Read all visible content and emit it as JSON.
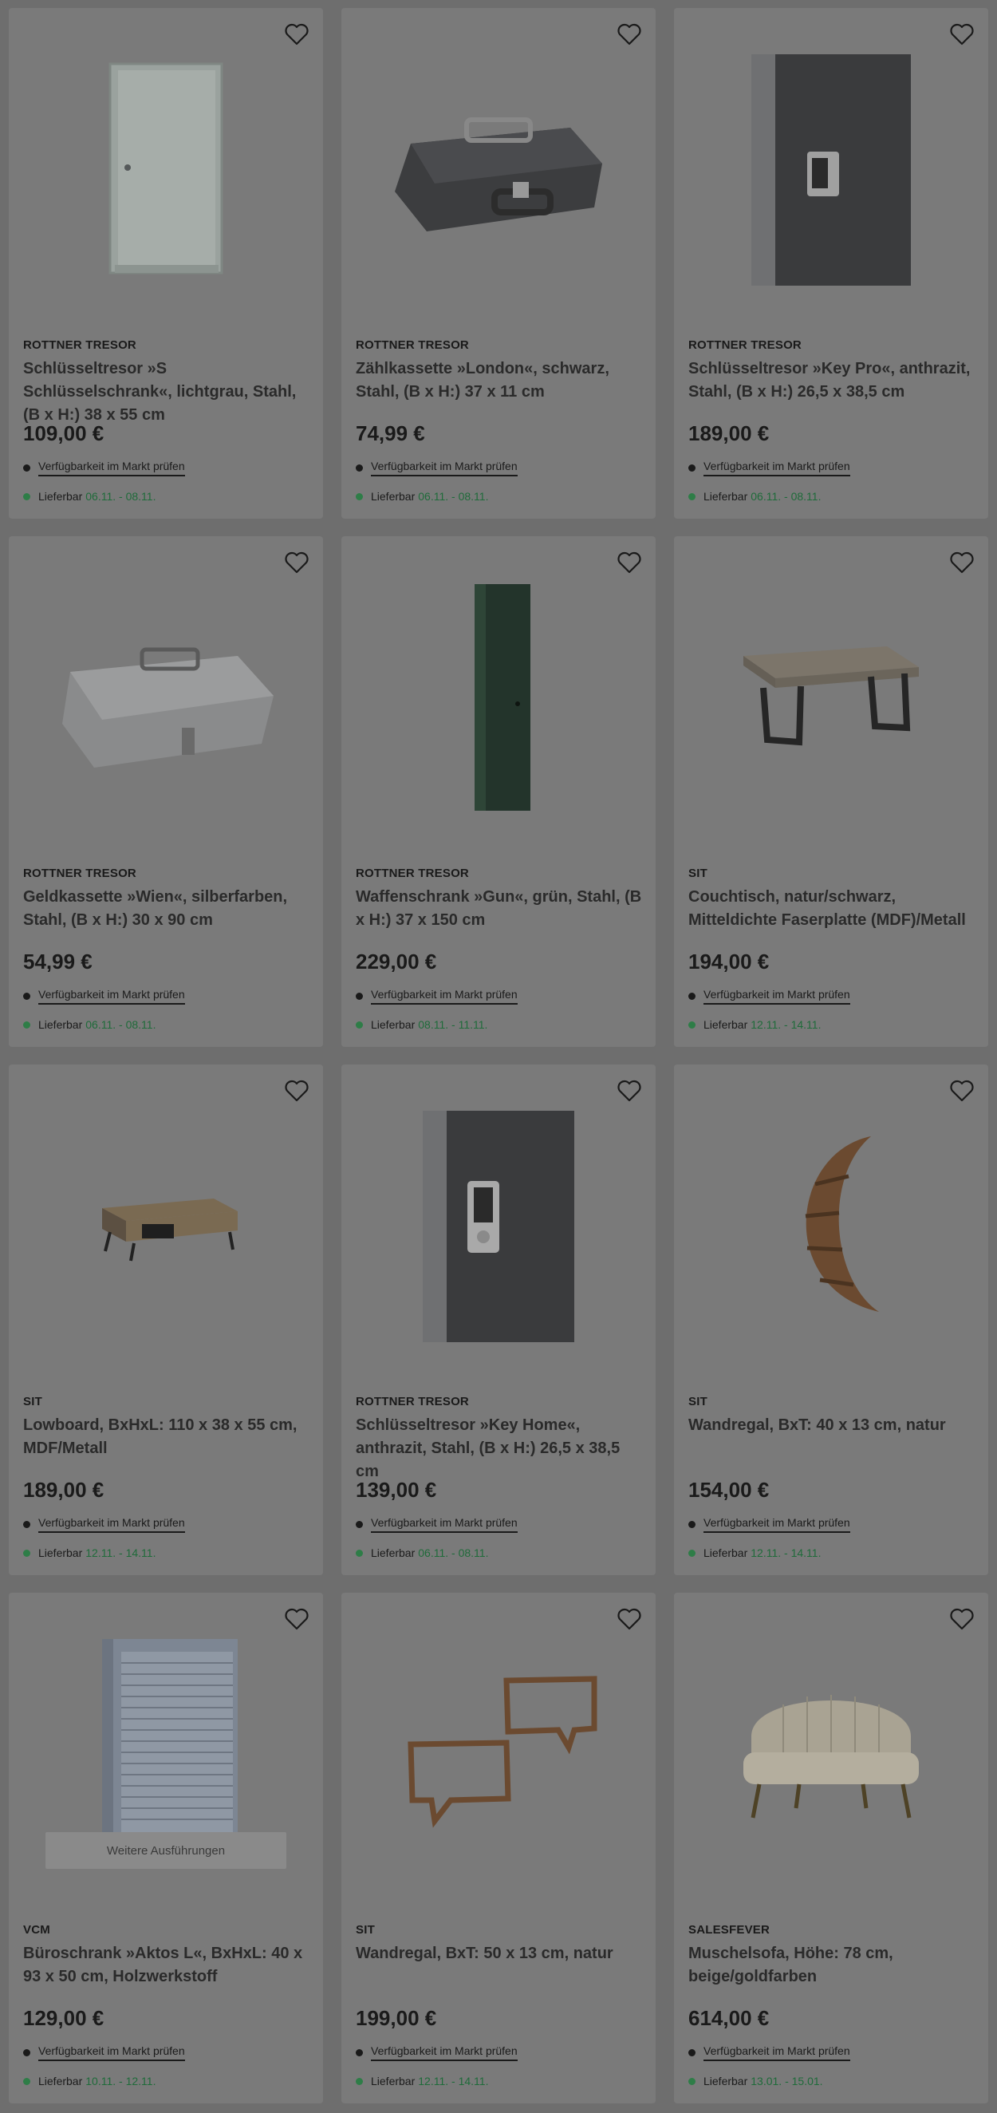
{
  "availability_label": "Verfügbarkeit im Markt prüfen",
  "delivery_label": "Lieferbar",
  "products": [
    {
      "brand": "ROTTNER TRESOR",
      "title": "Schlüsseltresor »S Schlüsselschrank«, lichtgrau, Stahl, (B x H:) 38 x 55 cm",
      "price": "109,00 €",
      "delivery": "06.11. - 08.11.",
      "icon": "key-cabinet-grey"
    },
    {
      "brand": "ROTTNER TRESOR",
      "title": "Zählkassette »London«, schwarz, Stahl, (B x H:) 37 x 11 cm",
      "price": "74,99 €",
      "delivery": "06.11. - 08.11.",
      "icon": "cash-box-black"
    },
    {
      "brand": "ROTTNER TRESOR",
      "title": "Schlüsseltresor »Key Pro«, anthrazit, Stahl, (B x H:) 26,5 x 38,5 cm",
      "price": "189,00 €",
      "delivery": "06.11. - 08.11.",
      "icon": "key-safe-anthracite"
    },
    {
      "brand": "ROTTNER TRESOR",
      "title": "Geldkassette »Wien«, silberfarben, Stahl, (B x H:) 30 x 90 cm",
      "price": "54,99 €",
      "delivery": "06.11. - 08.11.",
      "icon": "cash-box-silver"
    },
    {
      "brand": "ROTTNER TRESOR",
      "title": "Waffenschrank »Gun«, grün, Stahl, (B x H:) 37 x 150 cm",
      "price": "229,00 €",
      "delivery": "08.11. - 11.11.",
      "icon": "gun-cabinet-green"
    },
    {
      "brand": "SIT",
      "title": "Couchtisch, natur/schwarz, Mitteldichte Faserplatte (MDF)/Metall",
      "price": "194,00 €",
      "delivery": "12.11. - 14.11.",
      "icon": "coffee-table"
    },
    {
      "brand": "SIT",
      "title": "Lowboard, BxHxL: 110 x 38 x 55 cm, MDF/Metall",
      "price": "189,00 €",
      "delivery": "12.11. - 14.11.",
      "icon": "lowboard"
    },
    {
      "brand": "ROTTNER TRESOR",
      "title": "Schlüsseltresor »Key Home«, anthrazit, Stahl, (B x H:) 26,5 x 38,5 cm",
      "price": "139,00 €",
      "delivery": "06.11. - 08.11.",
      "icon": "key-safe-home"
    },
    {
      "brand": "SIT",
      "title": "Wandregal, BxT: 40 x 13 cm, natur",
      "price": "154,00 €",
      "delivery": "12.11. - 14.11.",
      "icon": "moon-shelf"
    },
    {
      "brand": "VCM",
      "title": "Büroschrank »Aktos L«, BxHxL: 40 x 93 x 50 cm, Holzwerkstoff",
      "price": "129,00 €",
      "delivery": "10.11. - 12.11.",
      "icon": "office-cabinet",
      "more_label": "Weitere Ausführungen"
    },
    {
      "brand": "SIT",
      "title": "Wandregal, BxT: 50 x 13 cm, natur",
      "price": "199,00 €",
      "delivery": "12.11. - 14.11.",
      "icon": "speech-bubble-shelves"
    },
    {
      "brand": "SALESFEVER",
      "title": "Muschelsofa, Höhe: 78 cm, beige/goldfarben",
      "price": "614,00 €",
      "delivery": "13.01. - 15.01.",
      "icon": "shell-sofa"
    }
  ]
}
